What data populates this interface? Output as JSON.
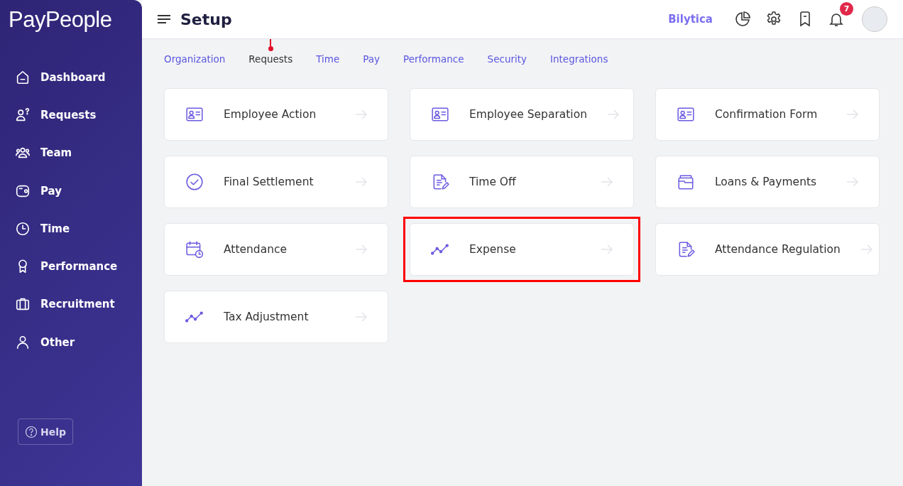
{
  "sidebar": {
    "logo": "PayPeople",
    "items": [
      {
        "label": "Dashboard",
        "kind": "home"
      },
      {
        "label": "Requests",
        "kind": "request"
      },
      {
        "label": "Team",
        "kind": "team"
      },
      {
        "label": "Pay",
        "kind": "wallet"
      },
      {
        "label": "Time",
        "kind": "clock"
      },
      {
        "label": "Performance",
        "kind": "award"
      },
      {
        "label": "Recruitment",
        "kind": "briefcase"
      },
      {
        "label": "Other",
        "kind": "user"
      }
    ],
    "help": "Help"
  },
  "header": {
    "title": "Setup",
    "company": "Bilytica",
    "notification_count": "7"
  },
  "tabs": [
    {
      "label": "Organization",
      "selected": false
    },
    {
      "label": "Requests",
      "selected": true
    },
    {
      "label": "Time",
      "selected": false
    },
    {
      "label": "Pay",
      "selected": false
    },
    {
      "label": "Performance",
      "selected": false
    },
    {
      "label": "Security",
      "selected": false
    },
    {
      "label": "Integrations",
      "selected": false
    }
  ],
  "cards": [
    {
      "label": "Employee Action",
      "kind": "idcard",
      "highlighted": false
    },
    {
      "label": "Employee Separation",
      "kind": "idcard",
      "highlighted": false
    },
    {
      "label": "Confirmation Form",
      "kind": "idcard",
      "highlighted": false
    },
    {
      "label": "Final Settlement",
      "kind": "check",
      "highlighted": false
    },
    {
      "label": "Time Off",
      "kind": "docedit",
      "highlighted": false
    },
    {
      "label": "Loans & Payments",
      "kind": "folders",
      "highlighted": false
    },
    {
      "label": "Attendance",
      "kind": "calendar",
      "highlighted": false
    },
    {
      "label": "Expense",
      "kind": "trend",
      "highlighted": true
    },
    {
      "label": "Attendance Regulation",
      "kind": "docedit",
      "highlighted": false
    },
    {
      "label": "Tax Adjustment",
      "kind": "trend",
      "highlighted": false
    }
  ]
}
